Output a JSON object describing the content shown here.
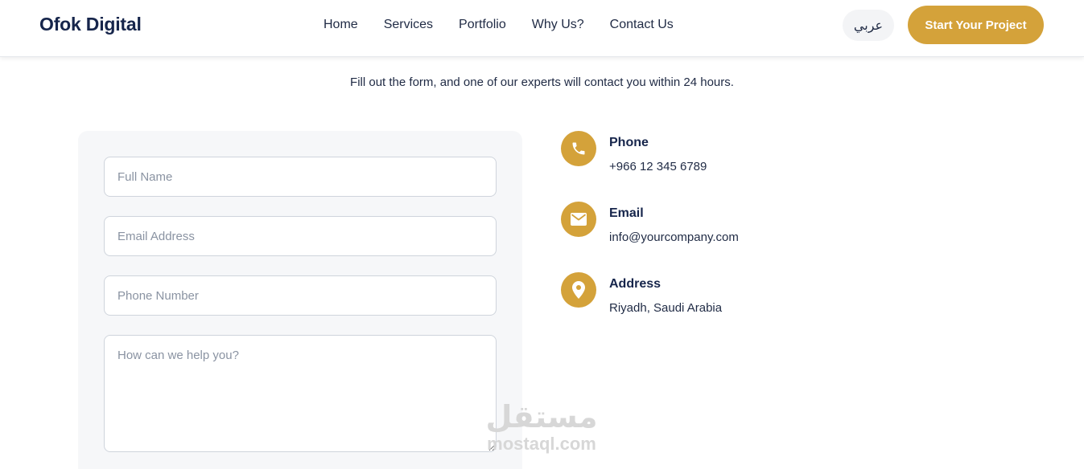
{
  "header": {
    "brand": "Ofok Digital",
    "nav": [
      {
        "label": "Home"
      },
      {
        "label": "Services"
      },
      {
        "label": "Portfolio"
      },
      {
        "label": "Why Us?"
      },
      {
        "label": "Contact Us"
      }
    ],
    "language_toggle": "عربي",
    "cta_label": "Start Your Project"
  },
  "contact_section": {
    "subtitle": "Fill out the form, and one of our experts will contact you within 24 hours.",
    "form": {
      "full_name": {
        "placeholder": "Full Name",
        "value": ""
      },
      "email": {
        "placeholder": "Email Address",
        "value": ""
      },
      "phone": {
        "placeholder": "Phone Number",
        "value": ""
      },
      "message": {
        "placeholder": "How can we help you?",
        "value": ""
      }
    },
    "info": [
      {
        "icon": "phone-icon",
        "title": "Phone",
        "value": "+966 12 345 6789"
      },
      {
        "icon": "envelope-icon",
        "title": "Email",
        "value": "info@yourcompany.com"
      },
      {
        "icon": "map-pin-icon",
        "title": "Address",
        "value": "Riyadh, Saudi Arabia"
      }
    ]
  },
  "watermark": {
    "arabic": "مستقل",
    "url": "mostaql.com"
  },
  "colors": {
    "accent": "#d4a23a",
    "brand": "#16254b",
    "card_background": "#f6f7f9"
  }
}
